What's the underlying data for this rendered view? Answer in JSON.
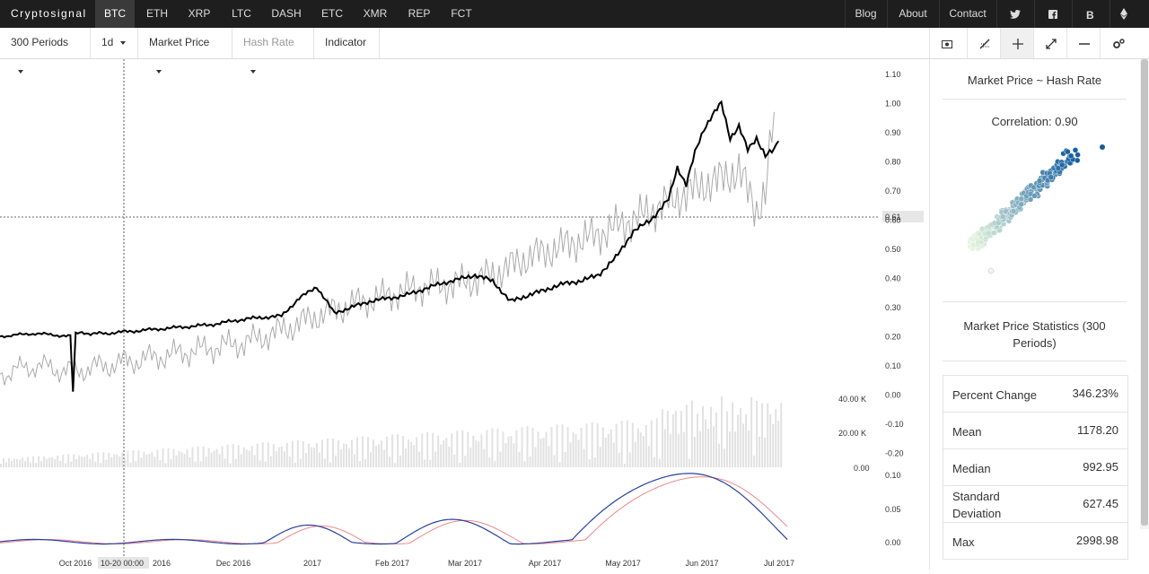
{
  "nav": {
    "brand": "Cryptosignal",
    "coins": [
      "BTC",
      "ETH",
      "XRP",
      "LTC",
      "DASH",
      "ETC",
      "XMR",
      "REP",
      "FCT"
    ],
    "active_coin": "BTC",
    "links": [
      "Blog",
      "About",
      "Contact"
    ],
    "social_icons": [
      "twitter-icon",
      "facebook-icon",
      "bitcoin-icon",
      "ethereum-icon"
    ]
  },
  "toolbar": {
    "periods": "300 Periods",
    "interval": "1d",
    "primary": "Market Price",
    "secondary": "Hash Rate",
    "indicator": "Indicator",
    "tool_icons": [
      "camera-icon",
      "no-draw-icon",
      "crosshair-icon",
      "expand-icon",
      "minus-icon",
      "settings-icon"
    ]
  },
  "sidebar": {
    "correlation_title": "Market Price ~ Hash Rate",
    "correlation_label": "Correlation: 0.90",
    "stats_title": "Market Price Statistics (300 Periods)",
    "stats": [
      {
        "label": "Percent Change",
        "value": "346.23%"
      },
      {
        "label": "Mean",
        "value": "1178.20"
      },
      {
        "label": "Median",
        "value": "992.95"
      },
      {
        "label": "Standard Deviation",
        "value": "627.45"
      },
      {
        "label": "Max",
        "value": "2998.98"
      }
    ]
  },
  "chart_data": {
    "type": "line",
    "x_ticks": [
      "Oct 2016",
      "Dec 2016",
      "2017",
      "Feb 2017",
      "Mar 2017",
      "Apr 2017",
      "May 2017",
      "Jun 2017",
      "Jul 2017"
    ],
    "main_axis": {
      "ticks": [
        "1.10",
        "1.00",
        "0.90",
        "0.80",
        "0.70",
        "0.60",
        "0.50",
        "0.40",
        "0.30",
        "0.20",
        "0.10",
        "0.00",
        "-0.10",
        "-0.20"
      ],
      "crosshair_value": "0.61"
    },
    "volume_axis": {
      "ticks": [
        "40.00 K",
        "20.00 K",
        "0.00"
      ]
    },
    "indicator_axis": {
      "ticks": [
        "0.10",
        "0.05",
        "0.00"
      ]
    },
    "crosshair_time": "10-20 00:00",
    "series": [
      {
        "color": "#000000",
        "points": [
          [
            0,
            0.2
          ],
          [
            0.04,
            0.21
          ],
          [
            0.08,
            0.2
          ],
          [
            0.083,
            0.01
          ],
          [
            0.086,
            0.21
          ],
          [
            0.12,
            0.21
          ],
          [
            0.16,
            0.22
          ],
          [
            0.2,
            0.23
          ],
          [
            0.24,
            0.24
          ],
          [
            0.28,
            0.26
          ],
          [
            0.32,
            0.27
          ],
          [
            0.34,
            0.33
          ],
          [
            0.36,
            0.37
          ],
          [
            0.38,
            0.28
          ],
          [
            0.42,
            0.32
          ],
          [
            0.46,
            0.34
          ],
          [
            0.5,
            0.38
          ],
          [
            0.54,
            0.41
          ],
          [
            0.56,
            0.39
          ],
          [
            0.58,
            0.32
          ],
          [
            0.6,
            0.34
          ],
          [
            0.62,
            0.36
          ],
          [
            0.64,
            0.38
          ],
          [
            0.66,
            0.39
          ],
          [
            0.68,
            0.41
          ],
          [
            0.7,
            0.47
          ],
          [
            0.72,
            0.56
          ],
          [
            0.74,
            0.6
          ],
          [
            0.76,
            0.67
          ],
          [
            0.77,
            0.78
          ],
          [
            0.78,
            0.72
          ],
          [
            0.79,
            0.83
          ],
          [
            0.8,
            0.91
          ],
          [
            0.81,
            0.96
          ],
          [
            0.82,
            1.0
          ],
          [
            0.83,
            0.88
          ],
          [
            0.84,
            0.92
          ],
          [
            0.85,
            0.84
          ],
          [
            0.86,
            0.88
          ],
          [
            0.87,
            0.82
          ],
          [
            0.88,
            0.84
          ],
          [
            0.885,
            0.87
          ]
        ]
      },
      {
        "color": "#aaaaaa",
        "points": [
          [
            0,
            0.07
          ],
          [
            0.04,
            0.1
          ],
          [
            0.08,
            0.08
          ],
          [
            0.12,
            0.1
          ],
          [
            0.16,
            0.12
          ],
          [
            0.2,
            0.14
          ],
          [
            0.24,
            0.16
          ],
          [
            0.28,
            0.18
          ],
          [
            0.32,
            0.22
          ],
          [
            0.36,
            0.27
          ],
          [
            0.4,
            0.31
          ],
          [
            0.44,
            0.34
          ],
          [
            0.48,
            0.37
          ],
          [
            0.52,
            0.38
          ],
          [
            0.56,
            0.41
          ],
          [
            0.6,
            0.47
          ],
          [
            0.64,
            0.51
          ],
          [
            0.68,
            0.55
          ],
          [
            0.72,
            0.6
          ],
          [
            0.76,
            0.66
          ],
          [
            0.8,
            0.72
          ],
          [
            0.82,
            0.74
          ],
          [
            0.84,
            0.77
          ],
          [
            0.86,
            0.63
          ],
          [
            0.87,
            0.69
          ],
          [
            0.88,
            0.97
          ]
        ]
      }
    ]
  }
}
